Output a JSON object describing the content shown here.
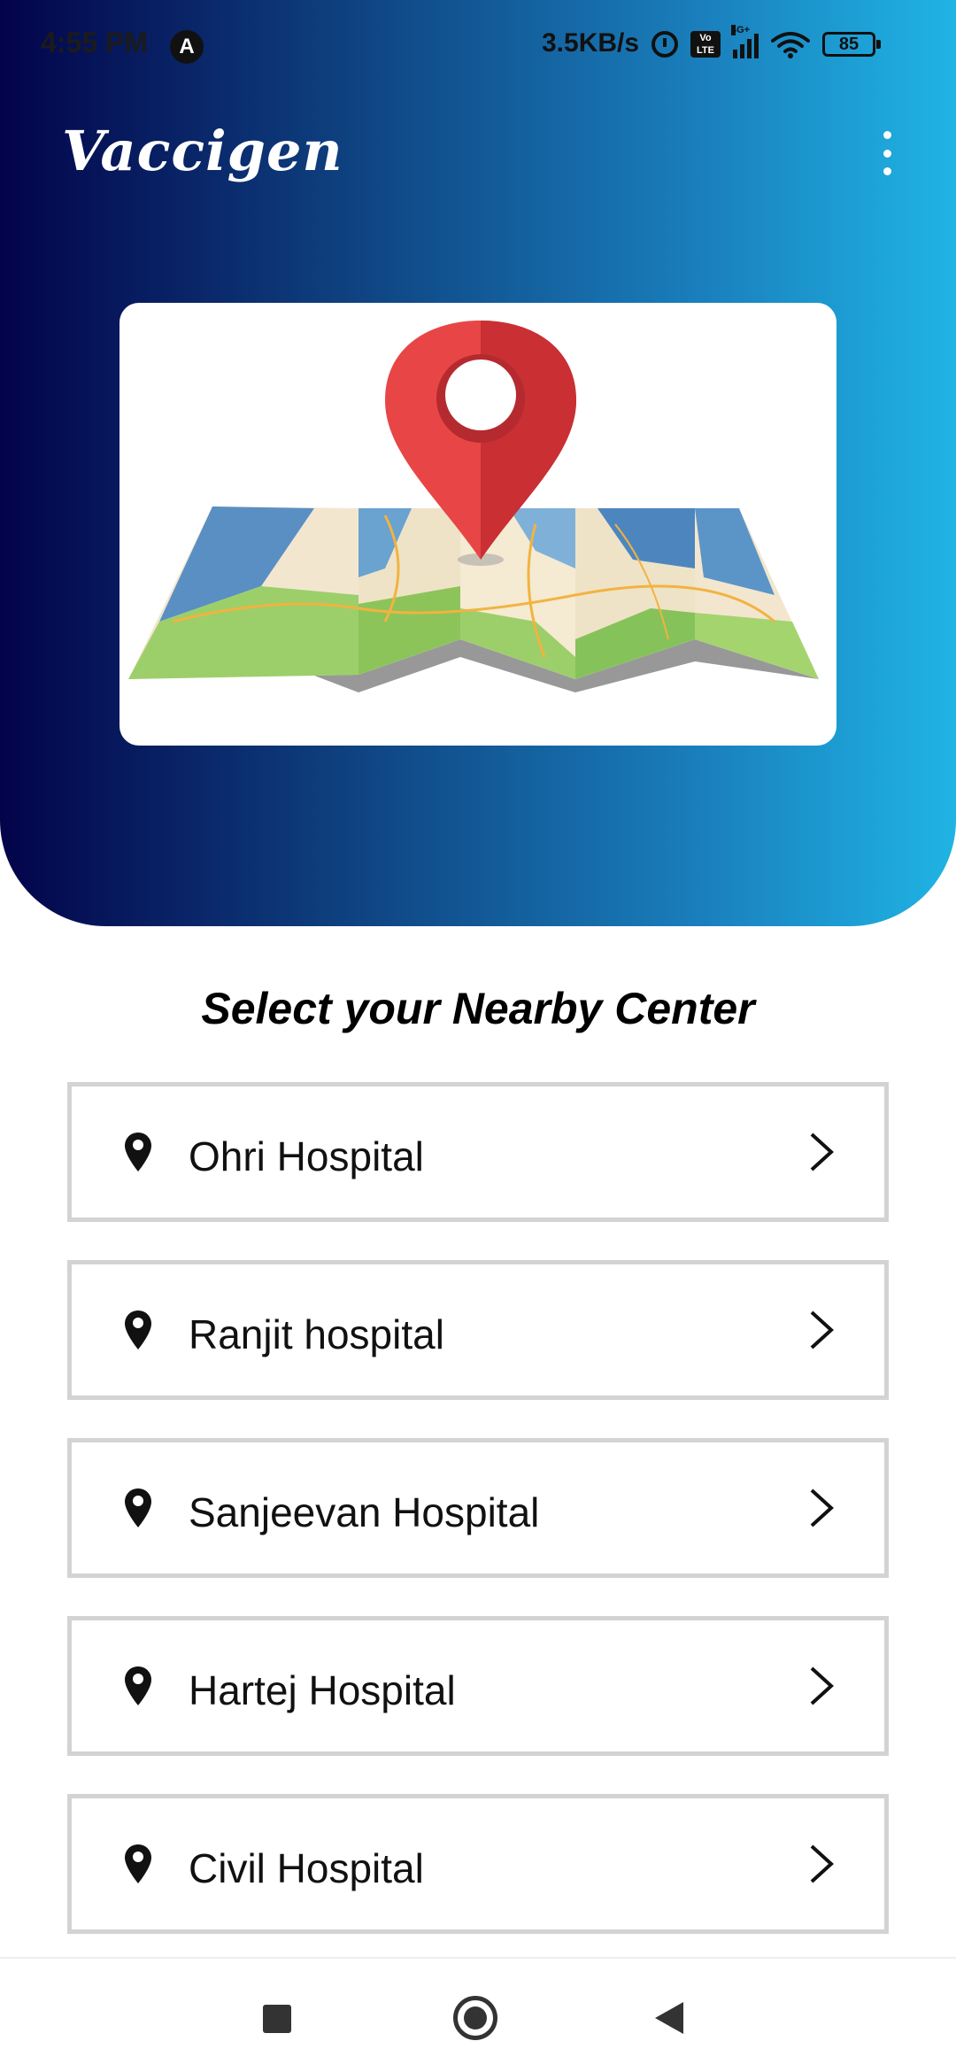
{
  "status_bar": {
    "time": "4:55 PM",
    "notification_badge": "A",
    "net_speed": "3.5KB/s",
    "volte_label": "Vo LTE",
    "network_type": "4G+",
    "battery_level": "85"
  },
  "app_bar": {
    "title": "Vaccigen",
    "menu_icon": "more-vert-icon"
  },
  "hero": {
    "illustration": "map-with-location-pin",
    "gradient_colors": [
      "#03034a",
      "#1fb4e4"
    ]
  },
  "main": {
    "heading": "Select your Nearby Center",
    "centers": [
      {
        "name": "Ohri Hospital",
        "icon": "location-pin-icon",
        "action_icon": "chevron-right-icon"
      },
      {
        "name": "Ranjit hospital",
        "icon": "location-pin-icon",
        "action_icon": "chevron-right-icon"
      },
      {
        "name": "Sanjeevan Hospital",
        "icon": "location-pin-icon",
        "action_icon": "chevron-right-icon"
      },
      {
        "name": "Hartej Hospital",
        "icon": "location-pin-icon",
        "action_icon": "chevron-right-icon"
      },
      {
        "name": "Civil Hospital",
        "icon": "location-pin-icon",
        "action_icon": "chevron-right-icon"
      }
    ]
  },
  "nav_bar": {
    "buttons": [
      "recents",
      "home",
      "back"
    ]
  }
}
